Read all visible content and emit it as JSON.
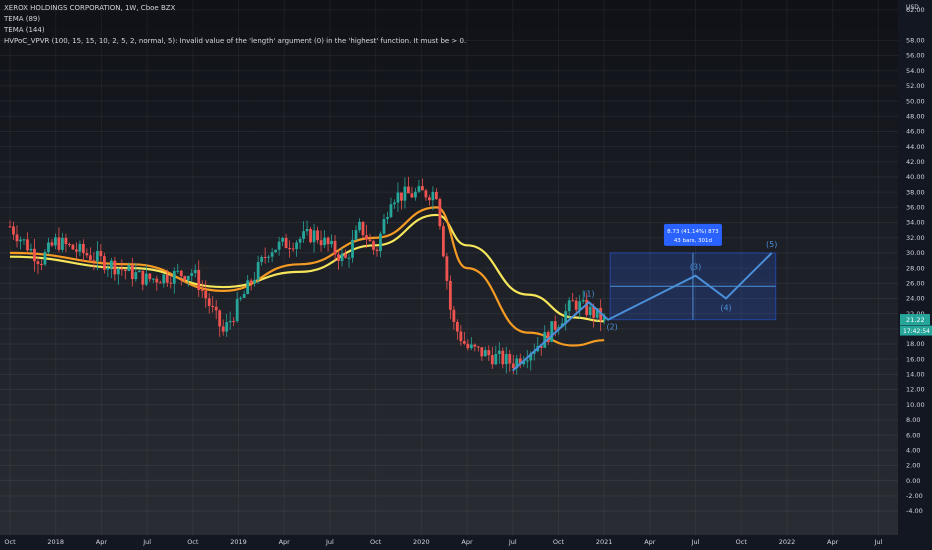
{
  "legend": {
    "title": "XEROX HOLDINGS CORPORATION, 1W, Cboe BZX",
    "tema1": "TEMA (89)",
    "tema2": "TEMA (144)",
    "error": "HVPoC_VPVR (100, 15, 15, 10, 2, 5, 2, normal, 5): Invalid value of the 'length' argument (0) in the 'highest' function. It must be > 0."
  },
  "currency": "USD",
  "price_axis": {
    "ticks": [
      "62.00",
      "58.00",
      "56.00",
      "54.00",
      "52.00",
      "50.00",
      "48.00",
      "46.00",
      "44.00",
      "42.00",
      "40.00",
      "38.00",
      "36.00",
      "34.00",
      "32.00",
      "30.00",
      "28.00",
      "26.00",
      "24.00",
      "22.00",
      "20.00",
      "18.00",
      "16.00",
      "14.00",
      "12.00",
      "10.00",
      "8.00",
      "6.00",
      "4.00",
      "2.00",
      "0.00",
      "-2.00",
      "-4.00"
    ],
    "last_price": "21.22",
    "countdown": "17:42:54",
    "last_color": "#26a69a"
  },
  "time_axis": {
    "labels": [
      "Oct",
      "2018",
      "Apr",
      "Jul",
      "Oct",
      "2019",
      "Apr",
      "Jul",
      "Oct",
      "2020",
      "Apr",
      "Jul",
      "Oct",
      "2021",
      "Apr",
      "Jul",
      "Oct",
      "2022",
      "Apr",
      "Jul"
    ]
  },
  "chart_data": {
    "type": "candlestick",
    "y_range": [
      -4,
      62.5
    ],
    "grid": true,
    "price_samples": [
      {
        "t": "2017-10",
        "price": 33.5
      },
      {
        "t": "2017-12",
        "price": 29.0
      },
      {
        "t": "2018-01",
        "price": 31.5
      },
      {
        "t": "2018-04",
        "price": 29.0
      },
      {
        "t": "2018-07",
        "price": 26.5
      },
      {
        "t": "2018-10",
        "price": 27.5
      },
      {
        "t": "2018-12",
        "price": 19.5
      },
      {
        "t": "2019-03",
        "price": 30.5
      },
      {
        "t": "2019-06",
        "price": 32.5
      },
      {
        "t": "2019-08",
        "price": 29.0
      },
      {
        "t": "2019-09",
        "price": 33.5
      },
      {
        "t": "2019-10",
        "price": 30.0
      },
      {
        "t": "2019-11",
        "price": 37.5
      },
      {
        "t": "2020-02",
        "price": 38.0
      },
      {
        "t": "2020-03",
        "price": 21.0
      },
      {
        "t": "2020-04",
        "price": 17.5
      },
      {
        "t": "2020-07",
        "price": 15.5
      },
      {
        "t": "2020-09",
        "price": 18.5
      },
      {
        "t": "2020-11",
        "price": 23.5
      },
      {
        "t": "2021-01",
        "price": 21.22
      }
    ],
    "series": [
      {
        "name": "TEMA (89)",
        "color": "#f5e55b",
        "points": [
          {
            "t": "2017-10",
            "v": 29.5
          },
          {
            "t": "2018-06",
            "v": 28.0
          },
          {
            "t": "2018-12",
            "v": 25.5
          },
          {
            "t": "2019-05",
            "v": 27.5
          },
          {
            "t": "2019-10",
            "v": 31.0
          },
          {
            "t": "2020-02",
            "v": 35.0
          },
          {
            "t": "2020-04",
            "v": 31.0
          },
          {
            "t": "2020-08",
            "v": 24.5
          },
          {
            "t": "2020-11",
            "v": 21.5
          },
          {
            "t": "2021-01",
            "v": 21.0
          }
        ]
      },
      {
        "name": "TEMA (144)",
        "color": "#f59a23",
        "points": [
          {
            "t": "2017-10",
            "v": 30.0
          },
          {
            "t": "2018-06",
            "v": 28.5
          },
          {
            "t": "2018-12",
            "v": 25.0
          },
          {
            "t": "2019-05",
            "v": 28.5
          },
          {
            "t": "2019-10",
            "v": 32.0
          },
          {
            "t": "2020-02",
            "v": 36.0
          },
          {
            "t": "2020-04",
            "v": 28.0
          },
          {
            "t": "2020-08",
            "v": 19.5
          },
          {
            "t": "2020-11",
            "v": 17.8
          },
          {
            "t": "2021-01",
            "v": 18.5
          }
        ]
      }
    ],
    "elliott_wave": {
      "color": "#4a90d9",
      "points": [
        {
          "t": "2020-07",
          "v": 14.5
        },
        {
          "t": "2020-12",
          "v": 23.5
        },
        {
          "t": "2021-01",
          "v": 21.2
        },
        {
          "t": "2021-07",
          "v": 27.0
        },
        {
          "t": "2021-09",
          "v": 24.0
        },
        {
          "t": "2021-12",
          "v": 30.0
        }
      ],
      "labels": [
        "(1)",
        "(2)",
        "(3)",
        "(4)",
        "(5)"
      ]
    },
    "measure": {
      "t_start": "2021-01",
      "t_end": "2021-12",
      "v_low": 21.2,
      "v_high": 30.0,
      "label1": "8.73 (41.14%) 873",
      "label2": "43 bars, 301d"
    }
  }
}
